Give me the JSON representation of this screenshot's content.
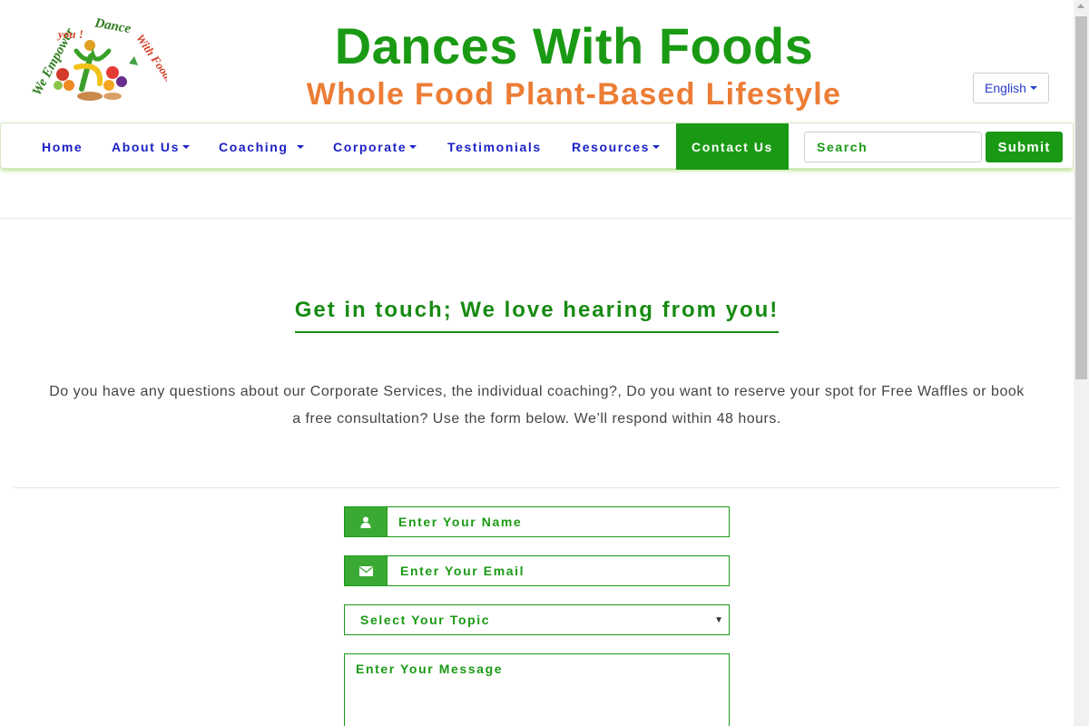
{
  "header": {
    "logo_alt": "We Empower you ! Dance With Foods",
    "title": "Dances With Foods",
    "subtitle": "Whole Food Plant-Based Lifestyle",
    "language": "English"
  },
  "nav": {
    "home": "Home",
    "about": "About Us",
    "coaching": "Coaching",
    "corporate": "Corporate",
    "testimonials": "Testimonials",
    "resources": "Resources",
    "contact": "Contact Us",
    "search_placeholder": "Search",
    "submit": "Submit"
  },
  "main": {
    "heading": "Get in touch; We love hearing from you!",
    "intro": "Do you have any questions about our Corporate Services, the individual coaching?, Do you want to reserve your spot for Free Waffles or book a free consultation? Use the form below. We’ll respond within 48 hours."
  },
  "form": {
    "name_placeholder": "Enter Your Name",
    "email_placeholder": "Enter Your Email",
    "topic_placeholder": "Select Your Topic",
    "message_placeholder": "Enter Your Message"
  },
  "icons": {
    "name": "user-icon",
    "email": "envelope-icon"
  },
  "colors": {
    "brand_green": "#1a9a14",
    "accent_orange": "#ec7d36",
    "nav_blue": "#1a1fc4"
  }
}
